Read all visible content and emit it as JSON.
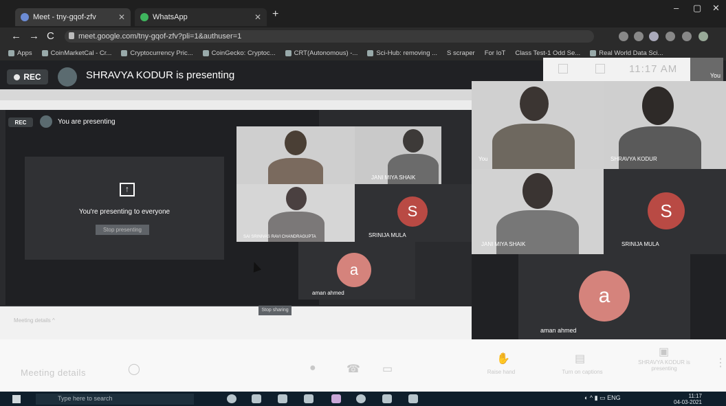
{
  "browser": {
    "tabs": [
      {
        "title": "Meet - tny-gqof-zfv",
        "active": true
      },
      {
        "title": "WhatsApp",
        "active": false
      }
    ],
    "new_tab": "+",
    "window_controls": [
      "–",
      "▢",
      "✕"
    ],
    "url": "meet.google.com/tny-gqof-zfv?pli=1&authuser=1",
    "bookmarks": [
      "Apps",
      "CoinMarketCal - Cr...",
      "Cryptocurrency Pric...",
      "CoinGecko: Cryptoc...",
      "CRT(Autonomous) -...",
      "Sci-Hub: removing ...",
      "S  scraper",
      "For IoT",
      "Class Test-1 Odd Se...",
      "Real World Data Sci..."
    ]
  },
  "meet": {
    "rec_label": "REC",
    "presenter_text": "SHRAVYA KODUR is presenting",
    "clock": "11:17 AM",
    "self_label": "You"
  },
  "shared_screen": {
    "rec_label": "REC",
    "presenting_text": "You are presenting",
    "presenting_card_text": "You're presenting to everyone",
    "stop_button": "Stop presenting",
    "meeting_details": "Meeting details ^",
    "share_button": "Stop sharing"
  },
  "shared_tiles": [
    {
      "name": "",
      "type": "video"
    },
    {
      "name": "JANI MIYA SHAIK",
      "type": "video"
    },
    {
      "name": "SAI SRINIVAS RAVI CHANDRAGUPTA",
      "type": "video"
    },
    {
      "name": "SRINIJA MULA",
      "type": "letter",
      "letter": "S",
      "color": "#d93025"
    },
    {
      "name": "aman ahmed",
      "type": "letter",
      "letter": "a",
      "color": "#e07b74"
    }
  ],
  "grid_tiles": [
    {
      "name": "You",
      "type": "video"
    },
    {
      "name": "SHRAVYA KODUR",
      "type": "video"
    },
    {
      "name": "JANI MIYA SHAIK",
      "type": "video"
    },
    {
      "name": "SRINIJA MULA",
      "type": "letter",
      "letter": "S",
      "color": "#d93025"
    },
    {
      "name": "aman ahmed",
      "type": "letter",
      "letter": "a",
      "color": "#e07b74"
    }
  ],
  "bottom_bar": {
    "meeting_details": "Meeting details",
    "raise_hand": "Raise hand",
    "captions": "Turn on captions",
    "present": "SHRAVYA KODUR is presenting"
  },
  "taskbar": {
    "search_placeholder": "Type here to search",
    "time": "11:17",
    "date": "04-03-2021",
    "language": "ENG"
  }
}
